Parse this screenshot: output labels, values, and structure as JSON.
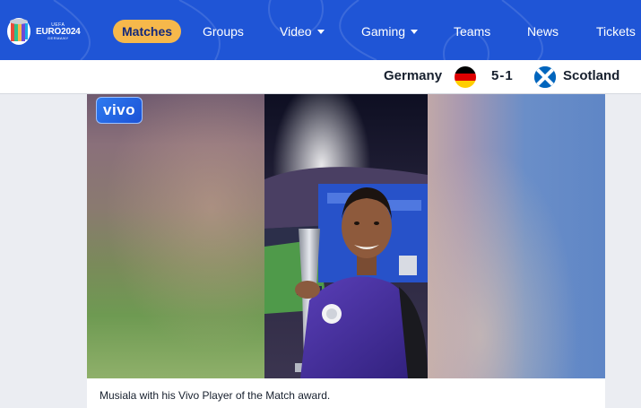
{
  "header": {
    "logo": {
      "org": "UEFA",
      "event": "EURO2024",
      "host": "GERMANY"
    },
    "nav": [
      {
        "label": "Matches",
        "active": true,
        "dropdown": false
      },
      {
        "label": "Groups",
        "active": false,
        "dropdown": false
      },
      {
        "label": "Video",
        "active": false,
        "dropdown": true
      },
      {
        "label": "Gaming",
        "active": false,
        "dropdown": true
      },
      {
        "label": "Teams",
        "active": false,
        "dropdown": false
      },
      {
        "label": "News",
        "active": false,
        "dropdown": false
      },
      {
        "label": "Tickets",
        "active": false,
        "dropdown": false
      }
    ],
    "colors": {
      "nav_bg": "#1f55d6",
      "active_pill": "#f6b84b"
    }
  },
  "match": {
    "home_team": "Germany",
    "home_flag": "germany-flag-icon",
    "score": "5-1",
    "away_team": "Scotland",
    "away_flag": "scotland-flag-icon"
  },
  "media": {
    "brand_badge": "vivo",
    "caption": "Musiala with his Vivo Player of the Match award."
  }
}
